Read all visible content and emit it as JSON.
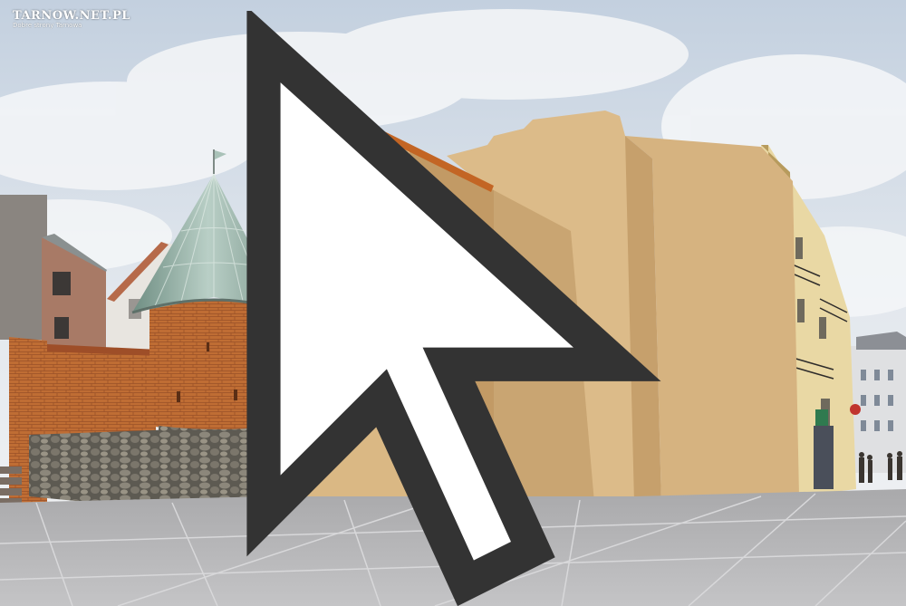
{
  "watermark": {
    "brand": "TARNOW.NET.PL",
    "tagline": "Dobre strony Tarnowa",
    "icon": "cursor-arrow-icon"
  },
  "scene": {
    "subject": "visualisation of a medieval brick tower with a glass conical roof beside plastered building walls on a paved square",
    "colors": {
      "sky": "#d6dee7",
      "plaster": "#d9b785",
      "plaster_shadow": "#c9a371",
      "brick": "#b8672f",
      "stone": "#6b665c",
      "glass_roof": "#8faaa0",
      "pavement": "#b9b9bb"
    }
  }
}
